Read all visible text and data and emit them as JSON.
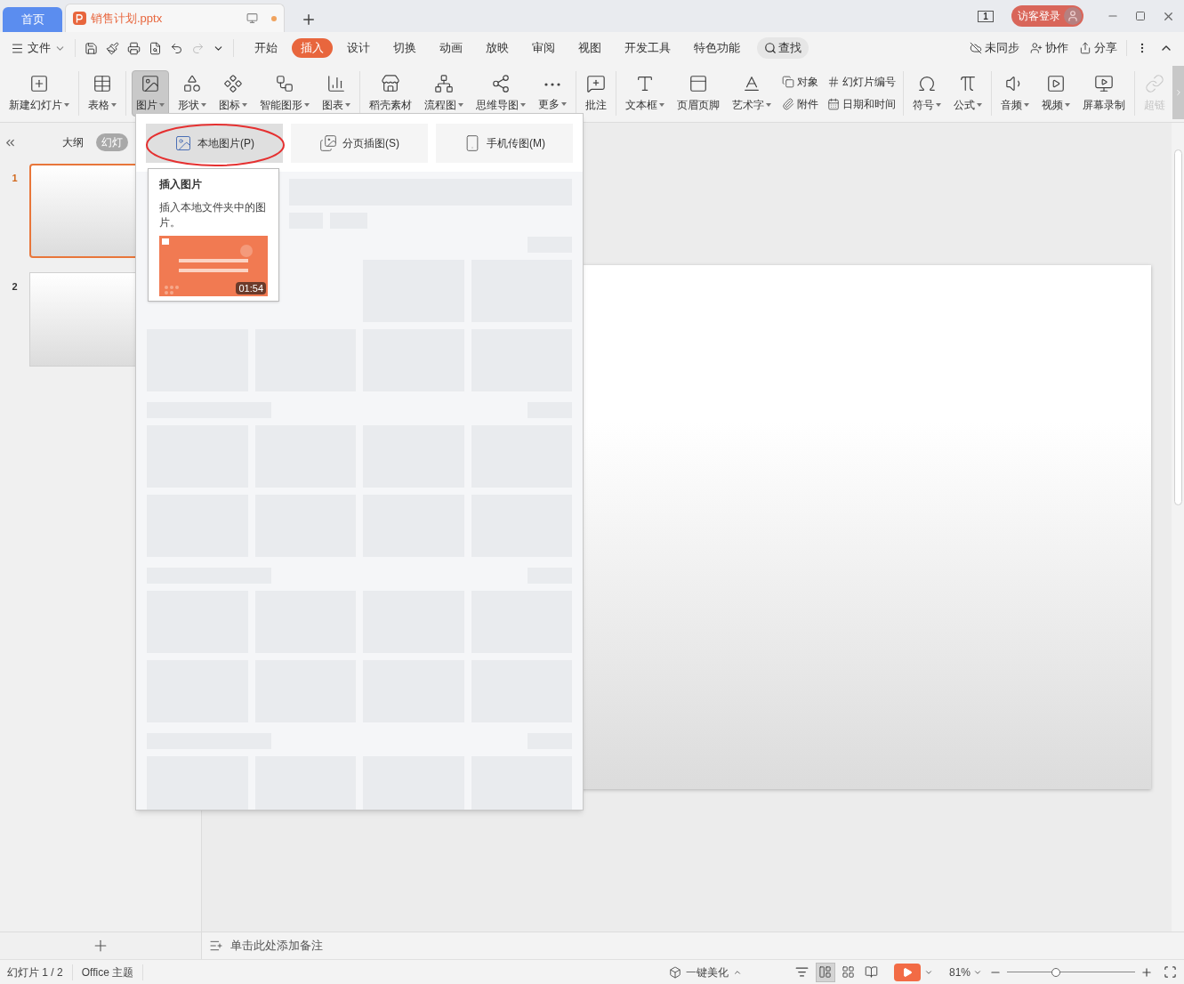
{
  "titlebar": {
    "tabs": [
      {
        "label": "首页",
        "kind": "home",
        "selected": false
      },
      {
        "label": "销售计划.pptx",
        "kind": "document",
        "selected": true
      }
    ],
    "window_count": "1",
    "login": "访客登录"
  },
  "menubar": {
    "file": "文件",
    "tabs": [
      {
        "label": "开始",
        "selected": false
      },
      {
        "label": "插入",
        "selected": true
      },
      {
        "label": "设计",
        "selected": false
      },
      {
        "label": "切换",
        "selected": false
      },
      {
        "label": "动画",
        "selected": false
      },
      {
        "label": "放映",
        "selected": false
      },
      {
        "label": "审阅",
        "selected": false
      },
      {
        "label": "视图",
        "selected": false
      },
      {
        "label": "开发工具",
        "selected": false
      },
      {
        "label": "特色功能",
        "selected": false
      }
    ],
    "search": "查找",
    "actions": [
      "未同步",
      "协作",
      "分享"
    ]
  },
  "ribbon": {
    "groups": [
      {
        "items": [
          {
            "kind": "large",
            "label": "新建幻灯片",
            "dropdown": true,
            "selected": false,
            "disabled": false
          }
        ]
      },
      {
        "items": [
          {
            "kind": "large",
            "label": "表格",
            "dropdown": true,
            "selected": false,
            "disabled": false
          }
        ]
      },
      {
        "items": [
          {
            "kind": "large",
            "label": "图片",
            "dropdown": true,
            "selected": true,
            "disabled": false
          },
          {
            "kind": "large",
            "label": "形状",
            "dropdown": true,
            "selected": false,
            "disabled": false
          },
          {
            "kind": "large",
            "label": "图标",
            "dropdown": true,
            "selected": false,
            "disabled": false
          },
          {
            "kind": "large",
            "label": "智能图形",
            "dropdown": true,
            "selected": false,
            "disabled": false
          },
          {
            "kind": "large",
            "label": "图表",
            "dropdown": true,
            "selected": false,
            "disabled": false
          }
        ]
      },
      {
        "items": [
          {
            "kind": "large",
            "label": "稻壳素材",
            "dropdown": false,
            "selected": false,
            "disabled": false
          },
          {
            "kind": "large",
            "label": "流程图",
            "dropdown": true,
            "selected": false,
            "disabled": false
          },
          {
            "kind": "large",
            "label": "思维导图",
            "dropdown": true,
            "selected": false,
            "disabled": false
          },
          {
            "kind": "large",
            "label": "更多",
            "dropdown": true,
            "selected": false,
            "disabled": false
          }
        ]
      },
      {
        "items": [
          {
            "kind": "large",
            "label": "批注",
            "dropdown": false,
            "selected": false,
            "disabled": false
          }
        ]
      },
      {
        "items": [
          {
            "kind": "large",
            "label": "文本框",
            "dropdown": true,
            "selected": false,
            "disabled": false
          },
          {
            "kind": "large",
            "label": "页眉页脚",
            "dropdown": false,
            "selected": false,
            "disabled": false
          },
          {
            "kind": "large",
            "label": "艺术字",
            "dropdown": true,
            "selected": false,
            "disabled": false
          },
          {
            "kind": "small",
            "label": "对象",
            "dropdown": false,
            "selected": false,
            "disabled": false
          },
          {
            "kind": "small",
            "label": "附件",
            "dropdown": false,
            "selected": false,
            "disabled": false
          },
          {
            "kind": "small",
            "label": "幻灯片编号",
            "dropdown": false,
            "selected": false,
            "disabled": false
          },
          {
            "kind": "small",
            "label": "日期和时间",
            "dropdown": false,
            "selected": false,
            "disabled": false
          }
        ]
      },
      {
        "items": [
          {
            "kind": "large",
            "label": "符号",
            "dropdown": true,
            "selected": false,
            "disabled": false
          },
          {
            "kind": "large",
            "label": "公式",
            "dropdown": true,
            "selected": false,
            "disabled": false
          }
        ]
      },
      {
        "items": [
          {
            "kind": "large",
            "label": "音频",
            "dropdown": true,
            "selected": false,
            "disabled": false
          },
          {
            "kind": "large",
            "label": "视频",
            "dropdown": true,
            "selected": false,
            "disabled": false
          },
          {
            "kind": "large",
            "label": "屏幕录制",
            "dropdown": false,
            "selected": false,
            "disabled": false
          }
        ]
      },
      {
        "items": [
          {
            "kind": "large",
            "label": "超链",
            "dropdown": false,
            "selected": false,
            "disabled": true
          }
        ]
      }
    ]
  },
  "sidebar": {
    "tabs": [
      {
        "label": "大纲",
        "selected": false
      },
      {
        "label": "幻灯",
        "selected": true
      }
    ],
    "slides": [
      {
        "number": "1",
        "selected": true
      },
      {
        "number": "2",
        "selected": false
      }
    ]
  },
  "picture_menu": {
    "options": [
      {
        "label": "本地图片(P)",
        "selected": true,
        "circled": true
      },
      {
        "label": "分页插图(S)",
        "selected": false,
        "circled": false
      },
      {
        "label": "手机传图(M)",
        "selected": false,
        "circled": false
      }
    ],
    "tooltip": {
      "title": "插入图片",
      "description": "插入本地文件夹中的图片。",
      "duration": "01:54"
    }
  },
  "notes": {
    "placeholder": "单击此处添加备注"
  },
  "status_bar": {
    "slide": "幻灯片 1 / 2",
    "theme": "Office 主题",
    "beautify": "一键美化",
    "views": [
      {
        "selected": true
      },
      {
        "selected": false
      },
      {
        "selected": false
      }
    ],
    "zoom": "81%",
    "level": 0.38
  }
}
